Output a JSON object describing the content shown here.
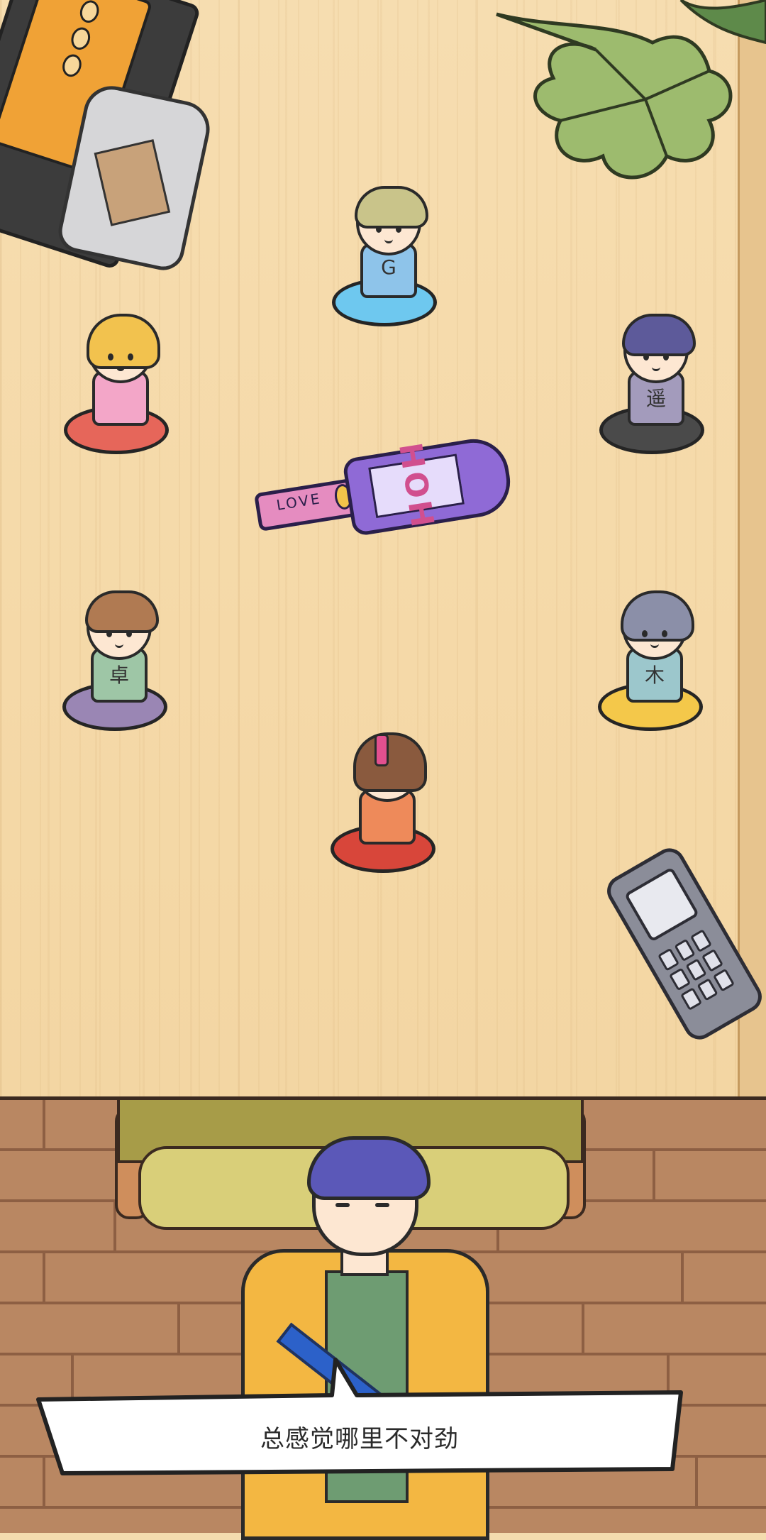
{
  "scene": {
    "dialogue": {
      "text": "总感觉哪里不对劲"
    },
    "bottle": {
      "label": "HOH",
      "neck_text": "LOVE"
    },
    "characters": [
      {
        "name": "glasses-boy",
        "shirt_text": "G",
        "cushion_color": "#6ec8ef"
      },
      {
        "name": "blonde-girl",
        "shirt_text": "",
        "cushion_color": "#e6665a"
      },
      {
        "name": "dark-hair-boy",
        "shirt_text": "遥",
        "cushion_color": "#4a4a4a"
      },
      {
        "name": "brown-hair-boy",
        "shirt_text": "卓",
        "cushion_color": "#9a86b4"
      },
      {
        "name": "gray-hair-girl",
        "shirt_text": "木",
        "cushion_color": "#f4c84a"
      },
      {
        "name": "pink-headband-girl",
        "shirt_text": "",
        "cushion_color": "#d8463a"
      }
    ]
  },
  "colors": {
    "table": "#f5d9a8",
    "floor": "#b98762",
    "sofa": "#d9cf79",
    "jacket": "#f3b742"
  }
}
